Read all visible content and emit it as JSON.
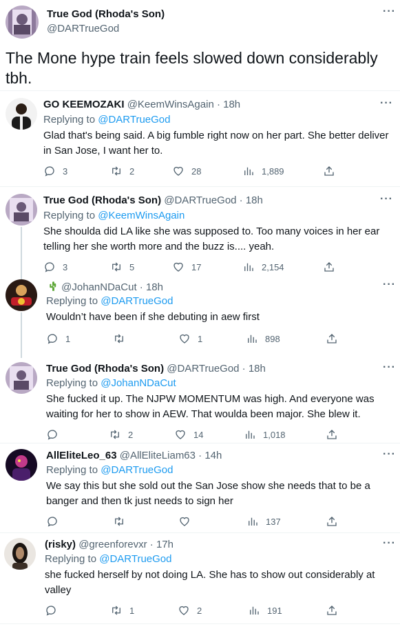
{
  "main_tweet": {
    "name": "True God (Rhoda's Son)",
    "handle": "@DARTrueGod",
    "text": "The Mone hype train feels slowed down considerably tbh."
  },
  "replies": [
    {
      "name": "GO KEEMOZAKI",
      "handle_time": "@KeemWinsAgain · 18h",
      "replying_label": "Replying to ",
      "replying_to": "@DARTrueGod",
      "text": "Glad that's being said. A big fumble right now on her part. She better deliver in San Jose, I want her to.",
      "replies": "3",
      "retweets": "2",
      "likes": "28",
      "views": "1,889"
    },
    {
      "name": "True God (Rhoda's Son)",
      "handle_time": "@DARTrueGod · 18h",
      "replying_label": "Replying to ",
      "replying_to": "@KeemWinsAgain",
      "text": "She shoulda did LA like she was supposed to. Too many voices in her ear telling her she worth more and the buzz is.... yeah.",
      "replies": "3",
      "retweets": "5",
      "likes": "17",
      "views": "2,154"
    },
    {
      "name": "",
      "handle_time": "@JohanNDaCut · 18h",
      "replying_label": "Replying to ",
      "replying_to": "@DARTrueGod",
      "text": "Wouldn’t have been if she debuting in aew first",
      "replies": "1",
      "retweets": "",
      "likes": "1",
      "views": "898"
    },
    {
      "name": "True God (Rhoda's Son)",
      "handle_time": "@DARTrueGod · 18h",
      "replying_label": "Replying to ",
      "replying_to": "@JohanNDaCut",
      "text": "She fucked it up. The NJPW MOMENTUM was high. And everyone was waiting for her to show in AEW. That woulda been major. She blew it.",
      "replies": "",
      "retweets": "2",
      "likes": "14",
      "views": "1,018"
    },
    {
      "name": "AllEliteLeo_63",
      "handle_time": "@AllEliteLiam63 · 14h",
      "replying_label": "Replying to ",
      "replying_to": "@DARTrueGod",
      "text": "We say this but she sold out the San Jose show she needs that to be a banger and then tk just needs to sign her",
      "replies": "",
      "retweets": "",
      "likes": "",
      "views": "137"
    },
    {
      "name": "(risky)",
      "handle_time": "@greenforevxr · 17h",
      "replying_label": "Replying to ",
      "replying_to": "@DARTrueGod",
      "text": "she fucked herself by not doing LA. She has to show out considerably at valley",
      "replies": "",
      "retweets": "1",
      "likes": "2",
      "views": "191"
    }
  ],
  "colors": {
    "link": "#1d9bf0",
    "muted": "#536471",
    "text": "#0f1419",
    "cactus": "#5fa839"
  },
  "icons": [
    "more-icon",
    "reply-icon",
    "retweet-icon",
    "like-icon",
    "views-icon",
    "share-icon",
    "cactus-emoji-icon"
  ]
}
